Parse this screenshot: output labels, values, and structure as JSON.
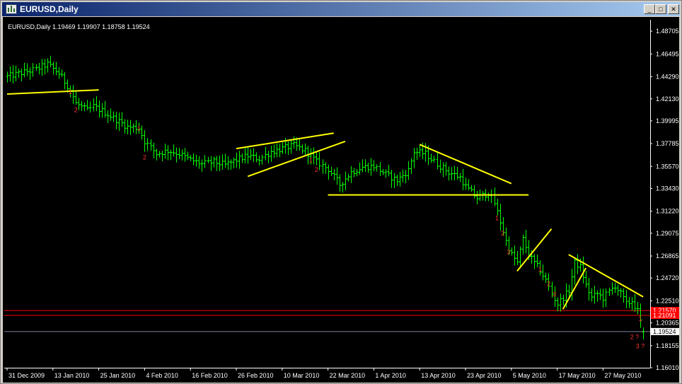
{
  "window": {
    "title": "EURUSD,Daily",
    "controls": {
      "minimize": "_",
      "maximize": "□",
      "close": "✕"
    }
  },
  "chart_header": "EURUSD,Daily  1.19469 1.19907 1.18758 1.19524",
  "price_labels": [
    "1.48705",
    "1.46495",
    "1.44290",
    "1.42130",
    "1.39995",
    "1.37785",
    "1.35570",
    "1.33430",
    "1.31220",
    "1.29075",
    "1.26865",
    "1.24720",
    "1.22510",
    "1.20365",
    "1.18155",
    "1.16010"
  ],
  "date_labels": [
    "31 Dec 2009",
    "13 Jan 2010",
    "25 Jan 2010",
    "4 Feb 2010",
    "16 Feb 2010",
    "26 Feb 2010",
    "10 Mar 2010",
    "22 Mar 2010",
    "1 Apr 2010",
    "13 Apr 2010",
    "23 Apr 2010",
    "5 May 2010",
    "17 May 2010",
    "27 May 2010"
  ],
  "price_tags": [
    {
      "label": "1.21570",
      "price": 1.2157,
      "bg": "#ff0000",
      "text_color": "#ffffff"
    },
    {
      "label": "1.21091",
      "price": 1.2109,
      "bg": "#ff0000",
      "text_color": "#ffffff"
    },
    {
      "label": "1.19524",
      "price": 1.19524,
      "bg": "#ffffff",
      "text_color": "#000000"
    }
  ],
  "markers": [
    {
      "text": "1",
      "bar": 22,
      "price": 1.4258
    },
    {
      "text": "2",
      "bar": 24,
      "price": 1.4085
    },
    {
      "text": "1",
      "bar": 46,
      "price": 1.3905
    },
    {
      "text": "2",
      "bar": 48,
      "price": 1.3624
    },
    {
      "text": "1",
      "bar": 106,
      "price": 1.3595
    },
    {
      "text": "2",
      "bar": 108,
      "price": 1.3505
    },
    {
      "text": "1",
      "bar": 171,
      "price": 1.3035
    },
    {
      "text": "2",
      "bar": 173,
      "price": 1.2885
    },
    {
      "text": "3",
      "bar": 175,
      "price": 1.2705
    },
    {
      "text": "1",
      "bar": 186,
      "price": 1.2535
    },
    {
      "text": "2",
      "bar": 189,
      "price": 1.2395
    },
    {
      "text": "3",
      "bar": 191,
      "price": 1.2295
    },
    {
      "text": "1",
      "bar": 221,
      "price": 1.2055
    },
    {
      "text": "2 ?",
      "bar": 219,
      "price": 1.188
    },
    {
      "text": "3 ?",
      "bar": 221,
      "price": 1.179
    }
  ],
  "colors": {
    "background": "#000000",
    "bars": "#00ff00",
    "trendlines": "#ffff00",
    "markers": "#ff3030",
    "hline_red": "#ff0000",
    "hline_bid": "#8080a0",
    "axis": "#ffffff"
  },
  "chart_data": {
    "type": "ohlc",
    "symbol": "EURUSD",
    "timeframe": "Daily",
    "last_bar": {
      "open": 1.19469,
      "high": 1.19907,
      "low": 1.18758,
      "close": 1.19524
    },
    "ylim": [
      1.1601,
      1.4981
    ],
    "y_ticks": [
      1.48705,
      1.46495,
      1.4429,
      1.4213,
      1.39995,
      1.37785,
      1.3557,
      1.3343,
      1.3122,
      1.29075,
      1.26865,
      1.2472,
      1.2251,
      1.20365,
      1.18155,
      1.1601
    ],
    "x_ticks": [
      {
        "bar": 0,
        "label": "31 Dec 2009"
      },
      {
        "bar": 16,
        "label": "13 Jan 2010"
      },
      {
        "bar": 32,
        "label": "25 Jan 2010"
      },
      {
        "bar": 48,
        "label": "4 Feb 2010"
      },
      {
        "bar": 64,
        "label": "16 Feb 2010"
      },
      {
        "bar": 80,
        "label": "26 Feb 2010"
      },
      {
        "bar": 96,
        "label": "10 Mar 2010"
      },
      {
        "bar": 112,
        "label": "22 Mar 2010"
      },
      {
        "bar": 128,
        "label": "1 Apr 2010"
      },
      {
        "bar": 144,
        "label": "13 Apr 2010"
      },
      {
        "bar": 160,
        "label": "23 Apr 2010"
      },
      {
        "bar": 176,
        "label": "5 May 2010"
      },
      {
        "bar": 192,
        "label": "17 May 2010"
      },
      {
        "bar": 208,
        "label": "27 May 2010"
      }
    ],
    "series_path": [
      [
        0,
        1.443
      ],
      [
        10,
        1.45
      ],
      [
        14,
        1.455
      ],
      [
        18,
        1.446
      ],
      [
        22,
        1.43
      ],
      [
        24,
        1.417
      ],
      [
        28,
        1.41
      ],
      [
        30,
        1.414
      ],
      [
        34,
        1.408
      ],
      [
        38,
        1.401
      ],
      [
        42,
        1.394
      ],
      [
        46,
        1.393
      ],
      [
        48,
        1.38
      ],
      [
        52,
        1.368
      ],
      [
        56,
        1.371
      ],
      [
        60,
        1.368
      ],
      [
        64,
        1.362
      ],
      [
        68,
        1.358
      ],
      [
        72,
        1.36
      ],
      [
        76,
        1.357
      ],
      [
        80,
        1.362
      ],
      [
        84,
        1.366
      ],
      [
        88,
        1.363
      ],
      [
        92,
        1.37
      ],
      [
        96,
        1.373
      ],
      [
        100,
        1.376
      ],
      [
        104,
        1.371
      ],
      [
        106,
        1.366
      ],
      [
        108,
        1.36
      ],
      [
        112,
        1.353
      ],
      [
        116,
        1.338
      ],
      [
        120,
        1.35
      ],
      [
        124,
        1.355
      ],
      [
        128,
        1.356
      ],
      [
        132,
        1.348
      ],
      [
        136,
        1.342
      ],
      [
        140,
        1.352
      ],
      [
        142,
        1.37
      ],
      [
        146,
        1.368
      ],
      [
        150,
        1.358
      ],
      [
        154,
        1.35
      ],
      [
        158,
        1.345
      ],
      [
        160,
        1.336
      ],
      [
        164,
        1.325
      ],
      [
        168,
        1.33
      ],
      [
        170,
        1.32
      ],
      [
        172,
        1.302
      ],
      [
        174,
        1.283
      ],
      [
        176,
        1.27
      ],
      [
        178,
        1.262
      ],
      [
        180,
        1.285
      ],
      [
        182,
        1.27
      ],
      [
        184,
        1.262
      ],
      [
        186,
        1.255
      ],
      [
        188,
        1.245
      ],
      [
        190,
        1.232
      ],
      [
        192,
        1.222
      ],
      [
        196,
        1.235
      ],
      [
        198,
        1.262
      ],
      [
        200,
        1.258
      ],
      [
        202,
        1.24
      ],
      [
        204,
        1.228
      ],
      [
        206,
        1.232
      ],
      [
        208,
        1.228
      ],
      [
        212,
        1.24
      ],
      [
        214,
        1.232
      ],
      [
        216,
        1.222
      ],
      [
        218,
        1.225
      ],
      [
        220,
        1.215
      ],
      [
        222,
        1.195
      ]
    ],
    "trendlines": [
      {
        "from": [
          0,
          1.426
        ],
        "to": [
          32,
          1.43
        ]
      },
      {
        "from": [
          80,
          1.373
        ],
        "to": [
          114,
          1.388
        ]
      },
      {
        "from": [
          84,
          1.346
        ],
        "to": [
          118,
          1.38
        ]
      },
      {
        "from": [
          112,
          1.328
        ],
        "to": [
          182,
          1.328
        ]
      },
      {
        "from": [
          144,
          1.377
        ],
        "to": [
          176,
          1.339
        ]
      },
      {
        "from": [
          178,
          1.254
        ],
        "to": [
          190,
          1.295
        ]
      },
      {
        "from": [
          194,
          1.217
        ],
        "to": [
          202,
          1.257
        ]
      },
      {
        "from": [
          196,
          1.27
        ],
        "to": [
          222,
          1.229
        ]
      }
    ],
    "hlines": [
      {
        "price": 1.2157,
        "color": "#ff0000"
      },
      {
        "price": 1.2109,
        "color": "#ff0000"
      },
      {
        "price": 1.19524,
        "color": "#8080a0"
      }
    ]
  }
}
